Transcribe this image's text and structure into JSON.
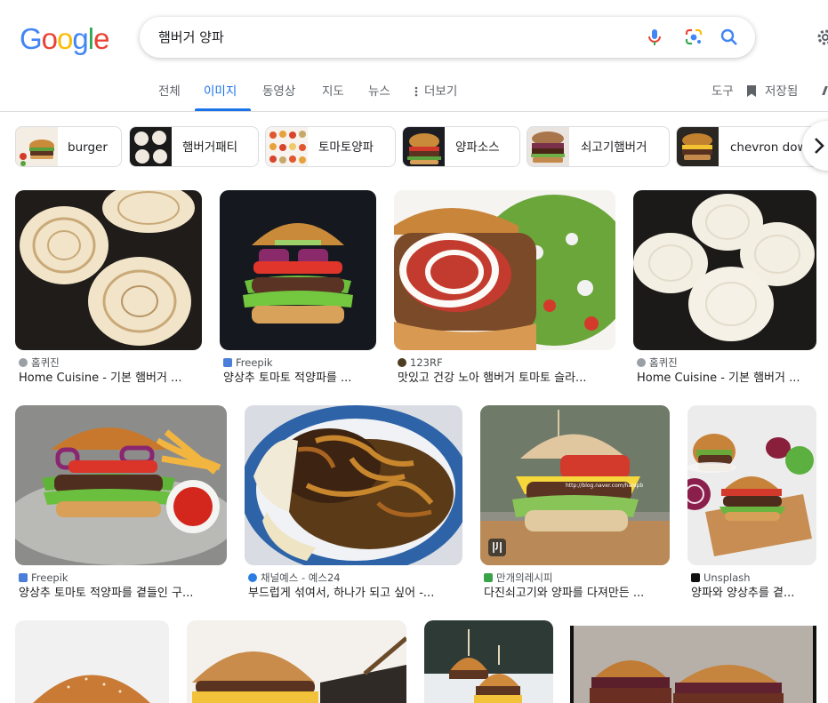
{
  "header": {
    "logo": [
      {
        "ch": "G",
        "color": "#4285F4"
      },
      {
        "ch": "o",
        "color": "#EA4335"
      },
      {
        "ch": "o",
        "color": "#FBBC05"
      },
      {
        "ch": "g",
        "color": "#4285F4"
      },
      {
        "ch": "l",
        "color": "#34A853"
      },
      {
        "ch": "e",
        "color": "#EA4335"
      }
    ],
    "query": "햄버거 양파"
  },
  "tabs": {
    "all": "전체",
    "images": "이미지",
    "videos": "동영상",
    "maps": "지도",
    "news": "뉴스",
    "more": "더보기",
    "tools": "도구",
    "saved": "저장됨"
  },
  "chips": [
    {
      "label": "burger"
    },
    {
      "label": "햄버거패티"
    },
    {
      "label": "토마토양파"
    },
    {
      "label": "양파소스"
    },
    {
      "label": "쇠고기햄버거"
    },
    {
      "label": "chevron dow"
    }
  ],
  "results": [
    {
      "source": "홈퀴진",
      "caption": "Home Cuisine - 기본 햄버거 ..."
    },
    {
      "source": "Freepik",
      "caption": "양상추 토마토 적양파를 ..."
    },
    {
      "source": "123RF",
      "caption": "맛있고 건강 노아 햄버거 토마토 슬라..."
    },
    {
      "source": "홈퀴진",
      "caption": "Home Cuisine - 기본 햄버거 ..."
    },
    {
      "source": "Freepik",
      "caption": "양상추 토마토 적양파를 곁들인 구..."
    },
    {
      "source": "채널예스 - 예스24",
      "caption": "부드럽게 섞여서, 하나가 되고 싶어 -..."
    },
    {
      "source": "만개의레시피",
      "caption": "다진쇠고기와 양파를 다져만든 ..."
    },
    {
      "source": "Unsplash",
      "caption": "양파와 양상추를 곁..."
    }
  ],
  "watermark": "http://blog.naver.com/hanipb"
}
